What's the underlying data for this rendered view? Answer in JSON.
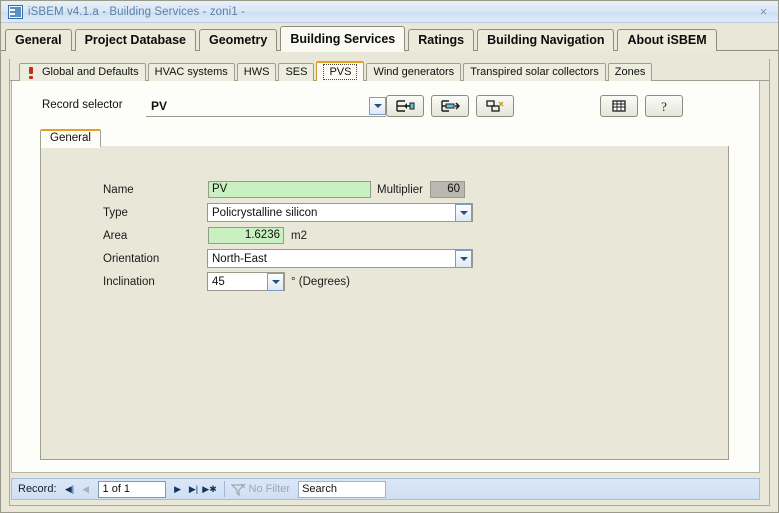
{
  "window": {
    "title": "iSBEM v4.1.a - Building Services - zoni1 -",
    "icon": "form-window-icon",
    "close_label": "×"
  },
  "main_tabs": [
    {
      "label": "General",
      "active": false
    },
    {
      "label": "Project Database",
      "active": false
    },
    {
      "label": "Geometry",
      "active": false
    },
    {
      "label": "Building Services",
      "active": true
    },
    {
      "label": "Ratings",
      "active": false
    },
    {
      "label": "Building Navigation",
      "active": false
    },
    {
      "label": "About iSBEM",
      "active": false
    }
  ],
  "sub_tabs": [
    {
      "label": "Global and Defaults",
      "active": false,
      "warning": true
    },
    {
      "label": "HVAC systems",
      "active": false,
      "warning": false
    },
    {
      "label": "HWS",
      "active": false,
      "warning": false
    },
    {
      "label": "SES",
      "active": false,
      "warning": false
    },
    {
      "label": "PVS",
      "active": true,
      "warning": false
    },
    {
      "label": "Wind generators",
      "active": false,
      "warning": false
    },
    {
      "label": "Transpired solar collectors",
      "active": false,
      "warning": false
    },
    {
      "label": "Zones",
      "active": false,
      "warning": false
    }
  ],
  "record_selector": {
    "label": "Record selector",
    "value": "PV",
    "dropdown_icon": "chevron-down-icon"
  },
  "toolbar": {
    "add_record_icon": "add-record-icon",
    "goto_record_icon": "goto-record-icon",
    "copy_record_icon": "copy-record-icon",
    "grid_view_icon": "table-grid-icon",
    "help_icon": "help-question-icon"
  },
  "inner_tab": {
    "label": "General"
  },
  "form": {
    "name": {
      "label": "Name",
      "value": "PV"
    },
    "multiplier": {
      "label": "Multiplier",
      "value": "60"
    },
    "type": {
      "label": "Type",
      "value": "Policrystalline silicon"
    },
    "area": {
      "label": "Area",
      "value": "1.6236",
      "unit": "m2"
    },
    "orientation": {
      "label": "Orientation",
      "value": "North-East"
    },
    "inclination": {
      "label": "Inclination",
      "value": "45",
      "unit": "° (Degrees)"
    }
  },
  "record_nav": {
    "label": "Record:",
    "first_icon": "first-record-icon",
    "prev_icon": "previous-record-icon",
    "position": "1 of 1",
    "next_icon": "next-record-icon",
    "last_icon": "last-record-icon",
    "new_icon": "new-record-icon",
    "filter_label": "No Filter",
    "filter_icon": "filter-icon",
    "search_value": "Search"
  },
  "colors": {
    "window_bg": "#e9e8d8",
    "titlebar": "#dce8f6",
    "accent_orange": "#e8a020",
    "field_green": "#c8f0c0",
    "field_gray": "#b8b8b0",
    "navbar_blue": "#d6e4f5"
  }
}
